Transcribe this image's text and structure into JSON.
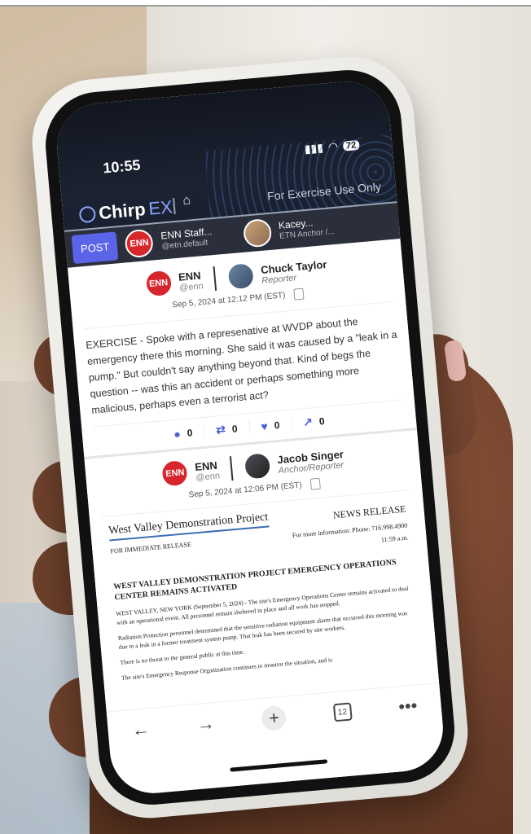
{
  "status": {
    "time": "10:55",
    "battery": "72"
  },
  "app": {
    "logo_main": "Chirp",
    "logo_ex": "EX",
    "exercise_label": "For Exercise Use Only"
  },
  "postbar": {
    "post_label": "POST",
    "account1": {
      "initials": "ENN",
      "name": "ENN Staff...",
      "handle": "@etn.default"
    },
    "account2": {
      "name": "Kacey...",
      "handle": "ETN Anchor /..."
    }
  },
  "posts": [
    {
      "org": "ENN",
      "org_handle": "@enn",
      "author": "Chuck Taylor",
      "role": "Reporter",
      "date": "Sep 5, 2024 at 12:12 PM (EST)",
      "body": "EXERCISE - Spoke with a represenative at WVDP about the emergency there this morning. She said it was caused by a \"leak in a pump.\" But couldn't say anything beyond that. Kind of begs the question -- was this an accident or perhaps something more malicious, perhaps even a terrorist act?",
      "counts": {
        "replies": "0",
        "reposts": "0",
        "likes": "0",
        "shares": "0"
      }
    },
    {
      "org": "ENN",
      "org_handle": "@enn",
      "author": "Jacob Singer",
      "role": "Anchor/Reporter",
      "date": "Sep 5, 2024 at 12:06 PM (EST)",
      "doc": {
        "project": "West Valley Demonstration Project",
        "news_release": "NEWS RELEASE",
        "immediate": "FOR IMMEDIATE RELEASE",
        "contact": "For more information: Phone: 716.998.4900",
        "time": "11:59 a.m.",
        "headline": "WEST VALLEY DEMONSTRATION PROJECT EMERGENCY OPERATIONS CENTER REMAINS ACTIVATED",
        "para1": "WEST VALLEY, NEW YORK (September 5, 2024) - The site's Emergency Operations Center remains activated to deal with an operational event. All personnel remain sheltered in place and all work has stopped.",
        "para2": "Radiation Protection personnel determined that the sensitive radiation equipment alarm that occurred this morning was due to a leak in a former treatment system pump. That leak has been secured by site workers.",
        "para3": "There is no threat to the general public at this time.",
        "para4": "The site's Emergency Response Organization continues to monitor the situation, and is"
      }
    }
  ],
  "bottom_nav": {
    "tab_count": "12"
  }
}
